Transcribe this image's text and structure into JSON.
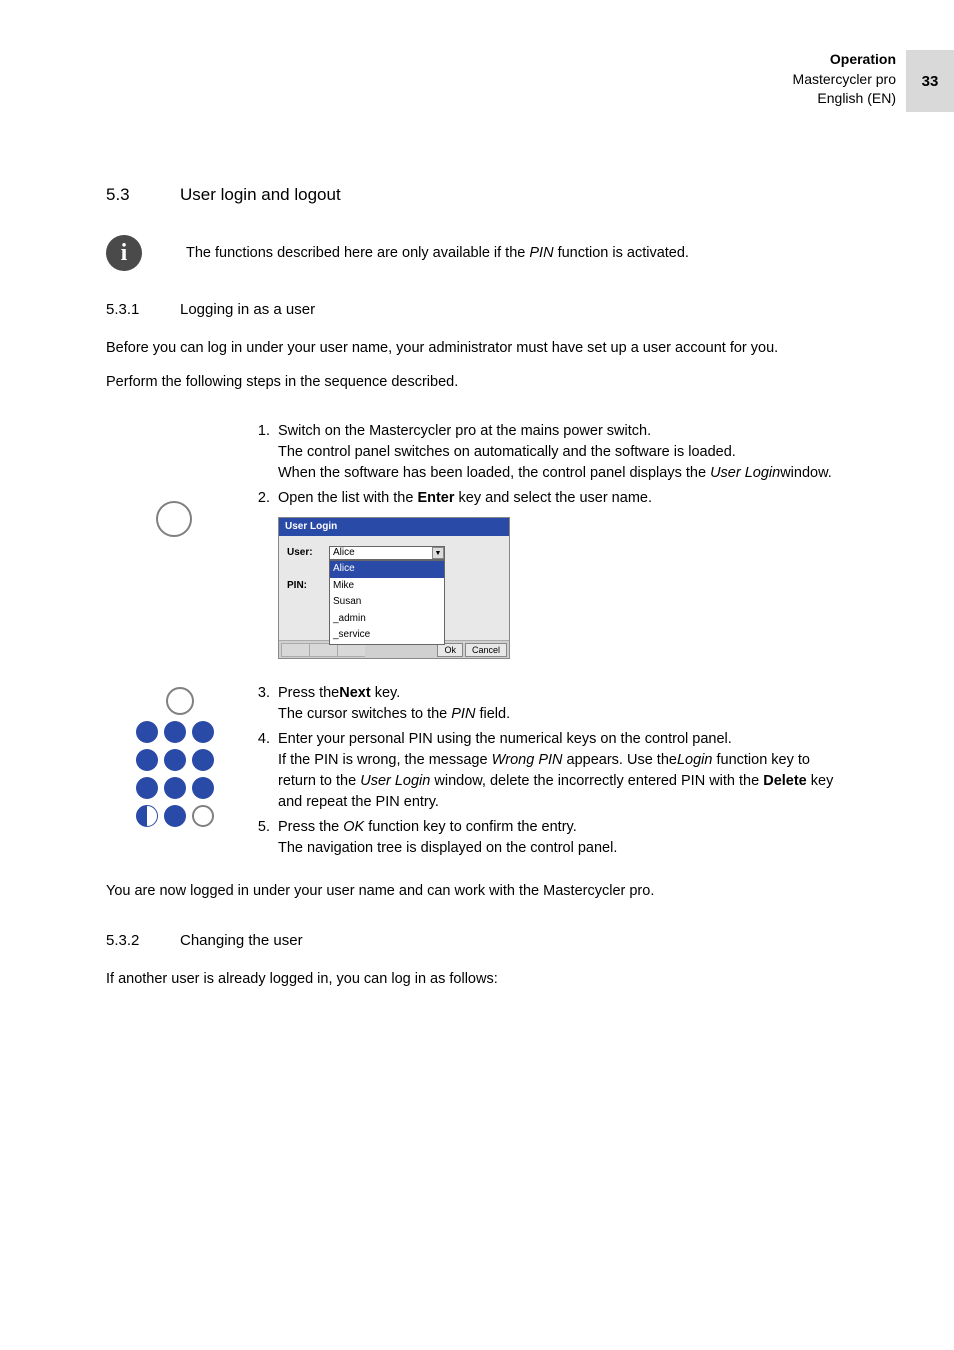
{
  "header": {
    "section": "Operation",
    "product": "Mastercycler pro",
    "language": "English (EN)",
    "page_number": "33"
  },
  "s53": {
    "num": "5.3",
    "title": "User login and logout"
  },
  "info_note": {
    "prefix": "The functions described here are only available if the ",
    "pin": "PIN",
    "suffix": " function is activated."
  },
  "s531": {
    "num": "5.3.1",
    "title": "Logging in as a user"
  },
  "para1": "Before you can log in under your user name, your administrator must have set up a user account for you.",
  "para2": "Perform the following steps in the sequence described.",
  "steps1": {
    "n1": "1.",
    "t1a": "Switch on the Mastercycler pro at the mains power switch.",
    "t1b": "The control panel switches on automatically and the software is loaded.",
    "t1c_pre": "When the software has been loaded, the control panel displays the ",
    "t1c_i": "User Login",
    "t1c_post": "window.",
    "n2": "2.",
    "t2_pre": "Open the list with the ",
    "t2_b": "Enter",
    "t2_post": " key and select the user name."
  },
  "login_dialog": {
    "title": "User Login",
    "user_label": "User:",
    "pin_label": "PIN:",
    "selected": "Alice",
    "options": [
      "Alice",
      "Mike",
      "Susan",
      "_admin",
      "_service"
    ],
    "ok": "Ok",
    "cancel": "Cancel"
  },
  "steps2": {
    "n3": "3.",
    "t3a_pre": "Press the",
    "t3a_b": "Next",
    "t3a_post": " key.",
    "t3b_pre": "The cursor switches to the ",
    "t3b_i": "PIN",
    "t3b_post": " field.",
    "n4": "4.",
    "t4a": "Enter your personal PIN using the numerical keys on the control panel.",
    "t4b_pre": "If the PIN is wrong, the message ",
    "t4b_i1": "Wrong PIN",
    "t4b_mid1": " appears. Use the",
    "t4b_i2": "Login",
    "t4b_mid2": " function key to return to the ",
    "t4b_i3": "User Login",
    "t4b_mid3": " window, delete the incorrectly entered PIN with the ",
    "t4b_b": "Delete",
    "t4b_post": " key and repeat the PIN entry.",
    "n5": "5.",
    "t5a_pre": "Press the ",
    "t5a_i": "OK",
    "t5a_post": " function key to confirm the entry.",
    "t5b": "The navigation tree is displayed on the control panel."
  },
  "para3": "You are now logged in under your user name and can work with the Mastercycler pro.",
  "s532": {
    "num": "5.3.2",
    "title": "Changing the user"
  },
  "para4": "If another user is already logged in, you can log in as follows:"
}
